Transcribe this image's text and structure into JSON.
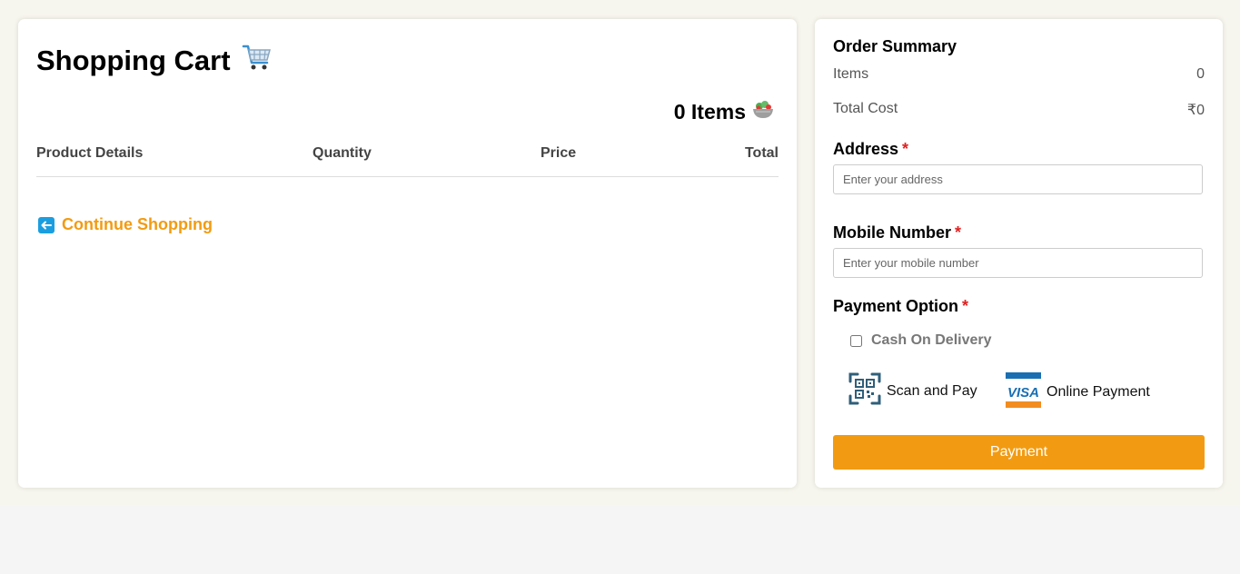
{
  "cart": {
    "title": "Shopping Cart",
    "items_count": "0 Items",
    "columns": [
      "Product Details",
      "Quantity",
      "Price",
      "Total"
    ],
    "continue_label": "Continue Shopping"
  },
  "summary": {
    "title": "Order Summary",
    "items_label": "Items",
    "items_value": "0",
    "total_label": "Total Cost",
    "total_value": "₹0",
    "address_label": "Address",
    "address_placeholder": "Enter your address",
    "mobile_label": "Mobile Number",
    "mobile_placeholder": "Enter your mobile number",
    "payment_option_label": "Payment Option",
    "required_mark": "*",
    "cod_label": "Cash On Delivery",
    "scan_label": "Scan and Pay",
    "online_label": "Online Payment",
    "visa_text": "VISA",
    "pay_button": "Payment"
  },
  "colors": {
    "accent": "#f29b12",
    "required": "#e02020",
    "visa_blue": "#1a6fb3"
  },
  "icons": [
    "shopping-cart-icon",
    "salad-bowl-icon",
    "back-arrow-icon",
    "qr-scan-icon",
    "visa-card-icon"
  ]
}
